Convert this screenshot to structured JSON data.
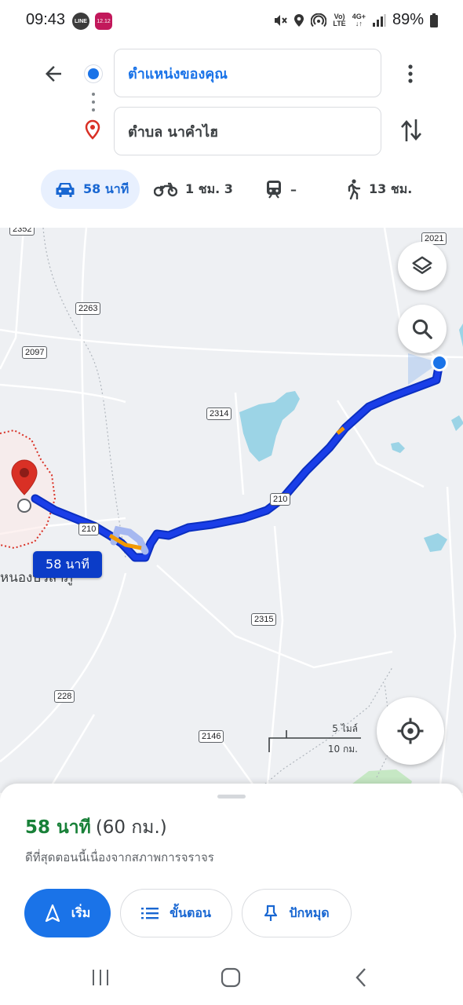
{
  "status_bar": {
    "time": "09:43",
    "line_icon_label": "LINE",
    "app_icon_label": "12.12",
    "network_labels": [
      "Vo)",
      "LTE",
      "4G+"
    ],
    "battery": "89%"
  },
  "directions": {
    "origin": "ตำแหน่งของคุณ",
    "destination": "ตำบล นาคำไฮ",
    "modes": [
      {
        "icon": "car-icon",
        "label": "58 นาที",
        "selected": true
      },
      {
        "icon": "motorcycle-icon",
        "label": "1 ชม. 3",
        "selected": false
      },
      {
        "icon": "transit-icon",
        "label": "–",
        "selected": false
      },
      {
        "icon": "walk-icon",
        "label": "13 ชม.",
        "selected": false
      }
    ]
  },
  "map": {
    "road_shields": [
      "2352",
      "2021",
      "2263",
      "2097",
      "2314",
      "210",
      "210",
      "2315",
      "228",
      "2146"
    ],
    "route_label": "58 นาที",
    "town_label": "หนองบัวลำภู",
    "scale_miles": "5 ไมล์",
    "scale_km": "10 กม.",
    "colors": {
      "route": "#1a3ee8",
      "water": "#9cd4e6",
      "origin": "#1a73e8",
      "destination": "#d93025"
    }
  },
  "sheet": {
    "duration": "58 นาที",
    "distance": "(60 กม.)",
    "note": "ดีที่สุดตอนนี้เนื่องจากสภาพการจราจร",
    "buttons": {
      "start": "เริ่ม",
      "steps": "ขั้นตอน",
      "pin": "ปักหมุด"
    }
  }
}
